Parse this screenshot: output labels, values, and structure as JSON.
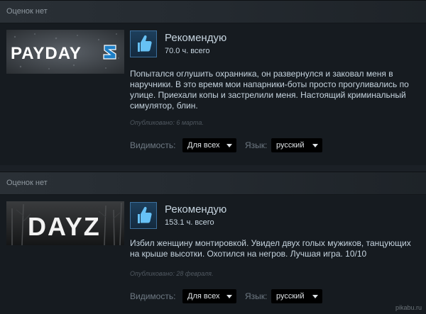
{
  "reviews": [
    {
      "helpful": "Оценок нет",
      "game_logo_text": "PAYDAY 2",
      "recommendation": "Рекомендую",
      "hours": "70.0 ч. всего",
      "text": "Попытался оглушить охранника, он развернулся и заковал меня в наручники. В это время мои напарники-боты просто прогуливались по улице. Приехали копы и застрелили меня. Настоящий криминальный симулятор, блин.",
      "posted": "Опубликовано: 6 марта.",
      "visibility_label": "Видимость:",
      "visibility_value": "Для всех",
      "language_label": "Язык:",
      "language_value": "русский"
    },
    {
      "helpful": "Оценок нет",
      "game_logo_text": "DAYZ",
      "recommendation": "Рекомендую",
      "hours": "153.1 ч. всего",
      "text": "Избил женщину монтировкой. Увидел двух голых мужиков, танцующих на крыше высотки. Охотился на негров. Лучшая игра. 10/10",
      "posted": "Опубликовано: 28 февраля.",
      "visibility_label": "Видимость:",
      "visibility_value": "Для всех",
      "language_label": "Язык:",
      "language_value": "русский"
    }
  ],
  "watermark": "pikabu.ru",
  "colors": {
    "background": "#1b2026",
    "panel": "#161b20",
    "accent_thumb": "#67c1f5",
    "text": "#c6d4df",
    "muted": "#6f7a84"
  }
}
